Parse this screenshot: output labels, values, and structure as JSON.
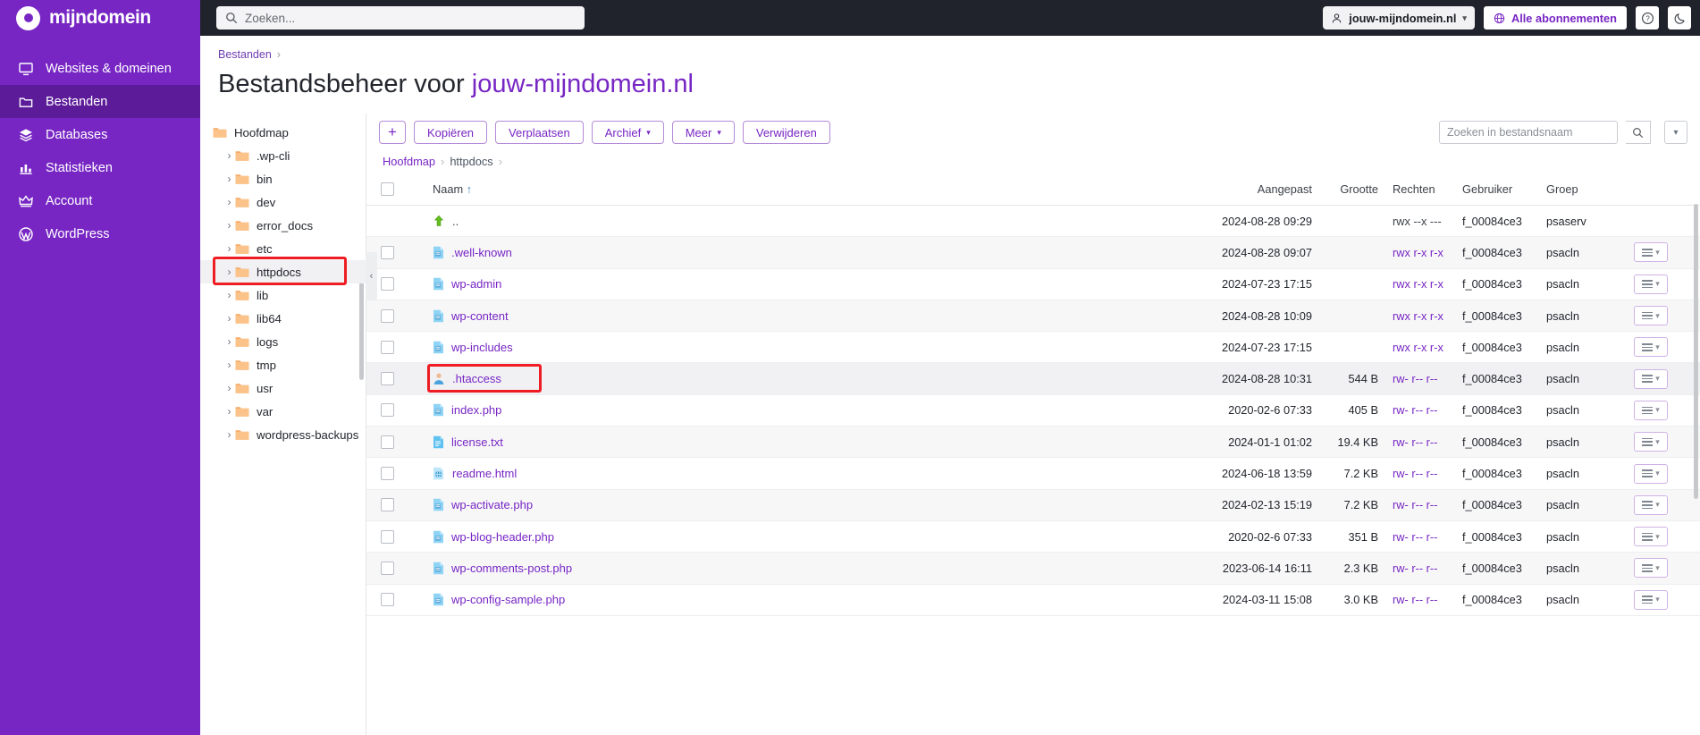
{
  "brand": {
    "name": "mijndomein",
    "accent": "#7726c4",
    "sidebar_bg": "#7726c4",
    "topbar_bg": "#20232b",
    "highlight": "#ee1d23"
  },
  "topbar": {
    "search_placeholder": "Zoeken...",
    "account_label": "jouw-mijndomein.nl",
    "subscriptions_label": "Alle abonnementen",
    "help_icon": "question-circle-icon",
    "theme_icon": "moon-icon"
  },
  "sidebar": {
    "items": [
      {
        "label": "Websites & domeinen",
        "icon": "monitor-icon",
        "active": false
      },
      {
        "label": "Bestanden",
        "icon": "folder-icon",
        "active": true
      },
      {
        "label": "Databases",
        "icon": "layers-icon",
        "active": false
      },
      {
        "label": "Statistieken",
        "icon": "bar-chart-icon",
        "active": false
      },
      {
        "label": "Account",
        "icon": "crown-icon",
        "active": false
      },
      {
        "label": "WordPress",
        "icon": "wordpress-icon",
        "active": false
      }
    ]
  },
  "page": {
    "breadcrumb_top": "Bestanden",
    "title_prefix": "Bestandsbeheer voor ",
    "title_domain": "jouw-mijndomein.nl"
  },
  "tree": {
    "root": "Hoofdmap",
    "items": [
      {
        "label": ".wp-cli",
        "selected": false
      },
      {
        "label": "bin",
        "selected": false
      },
      {
        "label": "dev",
        "selected": false
      },
      {
        "label": "error_docs",
        "selected": false
      },
      {
        "label": "etc",
        "selected": false
      },
      {
        "label": "httpdocs",
        "selected": true
      },
      {
        "label": "lib",
        "selected": false
      },
      {
        "label": "lib64",
        "selected": false
      },
      {
        "label": "logs",
        "selected": false
      },
      {
        "label": "tmp",
        "selected": false
      },
      {
        "label": "usr",
        "selected": false
      },
      {
        "label": "var",
        "selected": false
      },
      {
        "label": "wordpress-backups",
        "selected": false
      }
    ]
  },
  "toolbar": {
    "add_label": "+",
    "copy_label": "Kopiëren",
    "move_label": "Verplaatsen",
    "archive_label": "Archief",
    "more_label": "Meer",
    "delete_label": "Verwijderen",
    "search_placeholder": "Zoeken in bestandsnaam"
  },
  "breadcrumb": {
    "root": "Hoofdmap",
    "current": "httpdocs"
  },
  "table": {
    "columns": [
      "Naam",
      "Aangepast",
      "Grootte",
      "Rechten",
      "Gebruiker",
      "Groep"
    ],
    "sort_indicator": "↑",
    "rows": [
      {
        "name": "..",
        "icon": "up-arrow-icon",
        "date": "2024-08-28 09:29",
        "size": "",
        "perm": "rwx --x ---",
        "user": "f_00084ce3",
        "group": "psaserv",
        "checkbox": false,
        "actions": false,
        "perm_link": false,
        "name_link": false,
        "highlighted": false
      },
      {
        "name": ".well-known",
        "icon": "folder-icon",
        "date": "2024-08-28 09:07",
        "size": "",
        "perm": "rwx r-x r-x",
        "user": "f_00084ce3",
        "group": "psacln",
        "checkbox": true,
        "actions": true,
        "perm_link": true,
        "name_link": true,
        "highlighted": false
      },
      {
        "name": "wp-admin",
        "icon": "folder-icon",
        "date": "2024-07-23 17:15",
        "size": "",
        "perm": "rwx r-x r-x",
        "user": "f_00084ce3",
        "group": "psacln",
        "checkbox": true,
        "actions": true,
        "perm_link": true,
        "name_link": true,
        "highlighted": false
      },
      {
        "name": "wp-content",
        "icon": "folder-icon",
        "date": "2024-08-28 10:09",
        "size": "",
        "perm": "rwx r-x r-x",
        "user": "f_00084ce3",
        "group": "psacln",
        "checkbox": true,
        "actions": true,
        "perm_link": true,
        "name_link": true,
        "highlighted": false
      },
      {
        "name": "wp-includes",
        "icon": "folder-icon",
        "date": "2024-07-23 17:15",
        "size": "",
        "perm": "rwx r-x r-x",
        "user": "f_00084ce3",
        "group": "psacln",
        "checkbox": true,
        "actions": true,
        "perm_link": true,
        "name_link": true,
        "highlighted": false
      },
      {
        "name": ".htaccess",
        "icon": "htaccess-file-icon",
        "date": "2024-08-28 10:31",
        "size": "544 B",
        "perm": "rw- r-- r--",
        "user": "f_00084ce3",
        "group": "psacln",
        "checkbox": true,
        "actions": true,
        "perm_link": true,
        "name_link": true,
        "highlighted": true
      },
      {
        "name": "index.php",
        "icon": "php-file-icon",
        "date": "2020-02-6 07:33",
        "size": "405 B",
        "perm": "rw- r-- r--",
        "user": "f_00084ce3",
        "group": "psacln",
        "checkbox": true,
        "actions": true,
        "perm_link": true,
        "name_link": true,
        "highlighted": false
      },
      {
        "name": "license.txt",
        "icon": "txt-file-icon",
        "date": "2024-01-1 01:02",
        "size": "19.4 KB",
        "perm": "rw- r-- r--",
        "user": "f_00084ce3",
        "group": "psacln",
        "checkbox": true,
        "actions": true,
        "perm_link": true,
        "name_link": true,
        "highlighted": false
      },
      {
        "name": "readme.html",
        "icon": "html-file-icon",
        "date": "2024-06-18 13:59",
        "size": "7.2 KB",
        "perm": "rw- r-- r--",
        "user": "f_00084ce3",
        "group": "psacln",
        "checkbox": true,
        "actions": true,
        "perm_link": true,
        "name_link": true,
        "highlighted": false
      },
      {
        "name": "wp-activate.php",
        "icon": "php-file-icon",
        "date": "2024-02-13 15:19",
        "size": "7.2 KB",
        "perm": "rw- r-- r--",
        "user": "f_00084ce3",
        "group": "psacln",
        "checkbox": true,
        "actions": true,
        "perm_link": true,
        "name_link": true,
        "highlighted": false
      },
      {
        "name": "wp-blog-header.php",
        "icon": "php-file-icon",
        "date": "2020-02-6 07:33",
        "size": "351 B",
        "perm": "rw- r-- r--",
        "user": "f_00084ce3",
        "group": "psacln",
        "checkbox": true,
        "actions": true,
        "perm_link": true,
        "name_link": true,
        "highlighted": false
      },
      {
        "name": "wp-comments-post.php",
        "icon": "php-file-icon",
        "date": "2023-06-14 16:11",
        "size": "2.3 KB",
        "perm": "rw- r-- r--",
        "user": "f_00084ce3",
        "group": "psacln",
        "checkbox": true,
        "actions": true,
        "perm_link": true,
        "name_link": true,
        "highlighted": false
      },
      {
        "name": "wp-config-sample.php",
        "icon": "php-file-icon",
        "date": "2024-03-11 15:08",
        "size": "3.0 KB",
        "perm": "rw- r-- r--",
        "user": "f_00084ce3",
        "group": "psacln",
        "checkbox": true,
        "actions": true,
        "perm_link": true,
        "name_link": true,
        "highlighted": false
      }
    ]
  }
}
